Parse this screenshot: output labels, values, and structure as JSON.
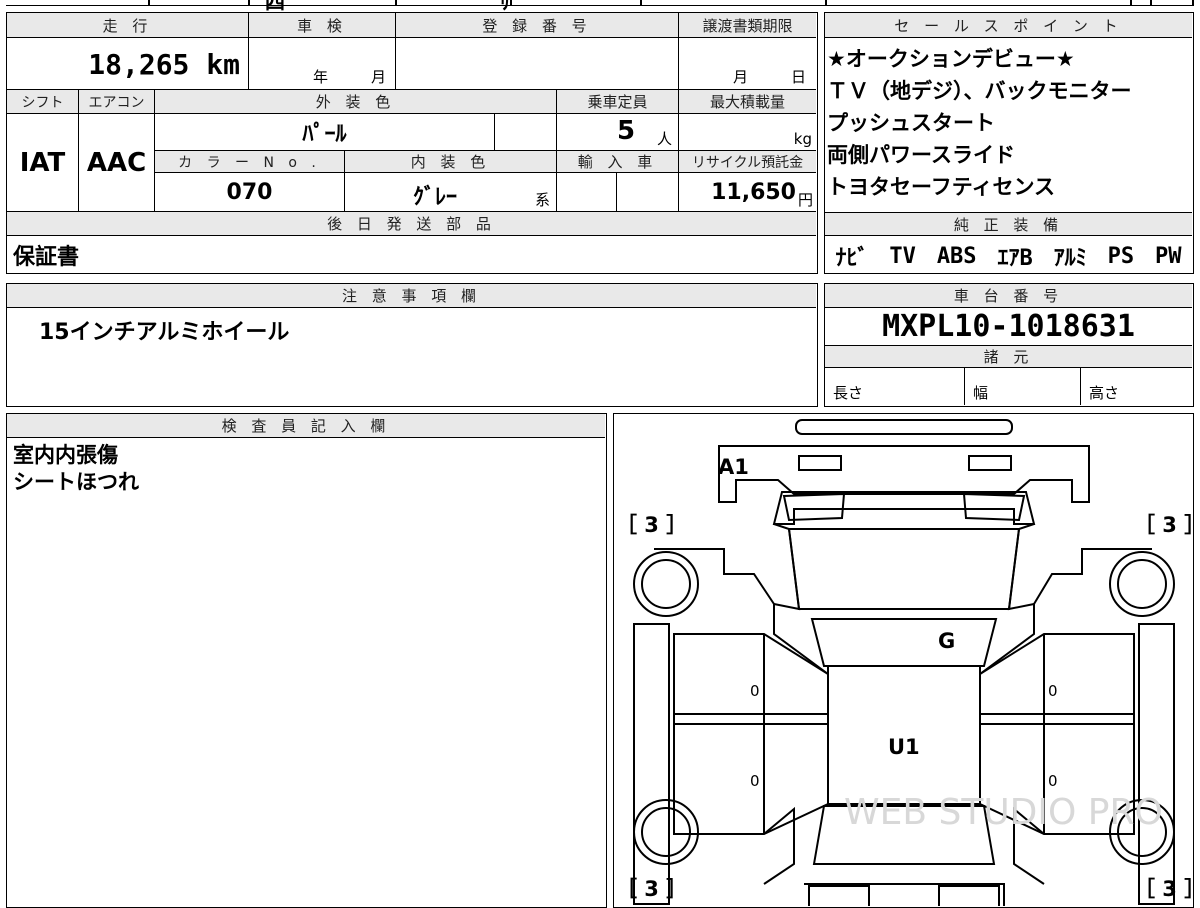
{
  "top_strip": {
    "partial_text": "四",
    "partial_text2": "ﾘ"
  },
  "main_table": {
    "mileage_header": "走 行",
    "mileage_value": "18,265",
    "mileage_unit": "km",
    "shaken_header": "車 検",
    "shaken_year": "年",
    "shaken_month": "月",
    "reg_header": "登 録 番 号",
    "transfer_header": "譲渡書類期限",
    "transfer_month": "月",
    "transfer_day": "日",
    "shift_header": "シフト",
    "shift_value": "IAT",
    "ac_header": "エアコン",
    "ac_value": "AAC",
    "ext_color_header": "外 装 色",
    "ext_color_value": "ﾊﾟｰﾙ",
    "capacity_header": "乗車定員",
    "capacity_value": "5",
    "capacity_unit": "人",
    "max_load_header": "最大積載量",
    "max_load_unit": "kg",
    "color_no_header": "カ ラ ー N o .",
    "color_no_value": "070",
    "int_color_header": "内 装 色",
    "int_color_value": "ｸﾞﾚｰ",
    "int_color_suffix": "系",
    "import_header": "輸 入 車",
    "recycle_header": "リサイクル預託金",
    "recycle_value": "11,650",
    "recycle_unit": "円",
    "later_parts_header": "後 日 発 送 部 品",
    "later_parts_value": "保証書"
  },
  "sales_points": {
    "header": "セ ー ル ス ポ イ ン ト",
    "lines": [
      "★オークションデビュー★",
      "ＴＶ（地デジ）、バックモニター",
      "プッシュスタート",
      "両側パワースライド",
      "トヨタセーフティセンス"
    ]
  },
  "equipment": {
    "header": "純 正 装 備",
    "items": [
      "ﾅﾋﾞ",
      "TV",
      "ABS",
      "ｴｱB",
      "ｱﾙﾐ",
      "PS",
      "PW"
    ]
  },
  "notes": {
    "header": "注 意 事 項 欄",
    "text": "15インチアルミホイール"
  },
  "chassis": {
    "header": "車 台 番 号",
    "value": "MXPL10-1018631"
  },
  "specs": {
    "header": "諸 元",
    "length": "長さ",
    "width": "幅",
    "height": "高さ"
  },
  "inspector": {
    "header": "検 査 員 記 入 欄",
    "lines": [
      "室内内張傷",
      "シートほつれ"
    ]
  },
  "diagram": {
    "marks": {
      "front_bumper": "A1",
      "windshield": "G",
      "roof": "U1"
    },
    "tires": [
      "［ 3 ］",
      "［ 3 ］",
      "［ 3 ］",
      "［ 3 ］"
    ],
    "door_zero": "0",
    "watermark": "WEB STUDIO PRO"
  }
}
